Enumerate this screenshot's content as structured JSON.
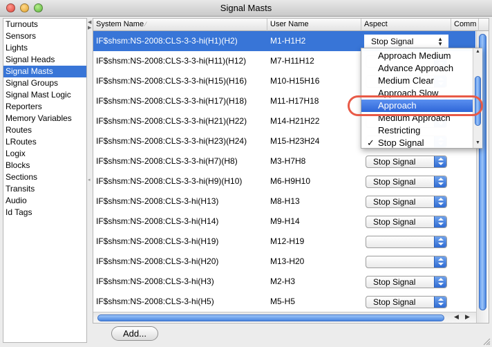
{
  "window": {
    "title": "Signal Masts"
  },
  "sidebar": {
    "items": [
      {
        "label": "Turnouts"
      },
      {
        "label": "Sensors"
      },
      {
        "label": "Lights"
      },
      {
        "label": "Signal Heads"
      },
      {
        "label": "Signal Masts",
        "selected": true
      },
      {
        "label": "Signal Groups"
      },
      {
        "label": "Signal Mast Logic"
      },
      {
        "label": "Reporters"
      },
      {
        "label": "Memory Variables"
      },
      {
        "label": "Routes"
      },
      {
        "label": "LRoutes"
      },
      {
        "label": "Logix"
      },
      {
        "label": "Blocks"
      },
      {
        "label": "Sections"
      },
      {
        "label": "Transits"
      },
      {
        "label": "Audio"
      },
      {
        "label": "Id Tags"
      }
    ]
  },
  "table": {
    "columns": {
      "system_name": "System Name",
      "user_name": "User Name",
      "aspect": "Aspect",
      "comment": "Comm"
    },
    "rows": [
      {
        "system_name": "IF$shsm:NS-2008:CLS-3-3-hi(H1)(H2)",
        "user_name": "M1-H1H2",
        "aspect": "Stop Signal"
      },
      {
        "system_name": "IF$shsm:NS-2008:CLS-3-3-hi(H11)(H12)",
        "user_name": "M7-H11H12",
        "aspect": ""
      },
      {
        "system_name": "IF$shsm:NS-2008:CLS-3-3-hi(H15)(H16)",
        "user_name": "M10-H15H16",
        "aspect": ""
      },
      {
        "system_name": "IF$shsm:NS-2008:CLS-3-3-hi(H17)(H18)",
        "user_name": "M11-H17H18",
        "aspect": ""
      },
      {
        "system_name": "IF$shsm:NS-2008:CLS-3-3-hi(H21)(H22)",
        "user_name": "M14-H21H22",
        "aspect": ""
      },
      {
        "system_name": "IF$shsm:NS-2008:CLS-3-3-hi(H23)(H24)",
        "user_name": "M15-H23H24",
        "aspect": ""
      },
      {
        "system_name": "IF$shsm:NS-2008:CLS-3-3-hi(H7)(H8)",
        "user_name": "M3-H7H8",
        "aspect": "Stop Signal"
      },
      {
        "system_name": "IF$shsm:NS-2008:CLS-3-3-hi(H9)(H10)",
        "user_name": "M6-H9H10",
        "aspect": "Stop Signal"
      },
      {
        "system_name": "IF$shsm:NS-2008:CLS-3-hi(H13)",
        "user_name": "M8-H13",
        "aspect": "Stop Signal"
      },
      {
        "system_name": "IF$shsm:NS-2008:CLS-3-hi(H14)",
        "user_name": "M9-H14",
        "aspect": "Stop Signal"
      },
      {
        "system_name": "IF$shsm:NS-2008:CLS-3-hi(H19)",
        "user_name": "M12-H19",
        "aspect": ""
      },
      {
        "system_name": "IF$shsm:NS-2008:CLS-3-hi(H20)",
        "user_name": "M13-H20",
        "aspect": ""
      },
      {
        "system_name": "IF$shsm:NS-2008:CLS-3-hi(H3)",
        "user_name": "M2-H3",
        "aspect": "Stop Signal"
      },
      {
        "system_name": "IF$shsm:NS-2008:CLS-3-hi(H5)",
        "user_name": "M5-H5",
        "aspect": "Stop Signal"
      }
    ]
  },
  "aspect_dropdown": {
    "options": [
      {
        "label": "Approach Medium"
      },
      {
        "label": "Advance Approach"
      },
      {
        "label": "Medium Clear"
      },
      {
        "label": "Approach Slow"
      },
      {
        "label": "Approach",
        "highlighted": true
      },
      {
        "label": "Medium Approach"
      },
      {
        "label": "Restricting"
      },
      {
        "label": "Stop Signal",
        "checked": true
      }
    ],
    "check_mark": "✓"
  },
  "buttons": {
    "add_label": "Add..."
  },
  "colors": {
    "selection": "#3875d7",
    "annotation_ring": "#e85a47"
  }
}
